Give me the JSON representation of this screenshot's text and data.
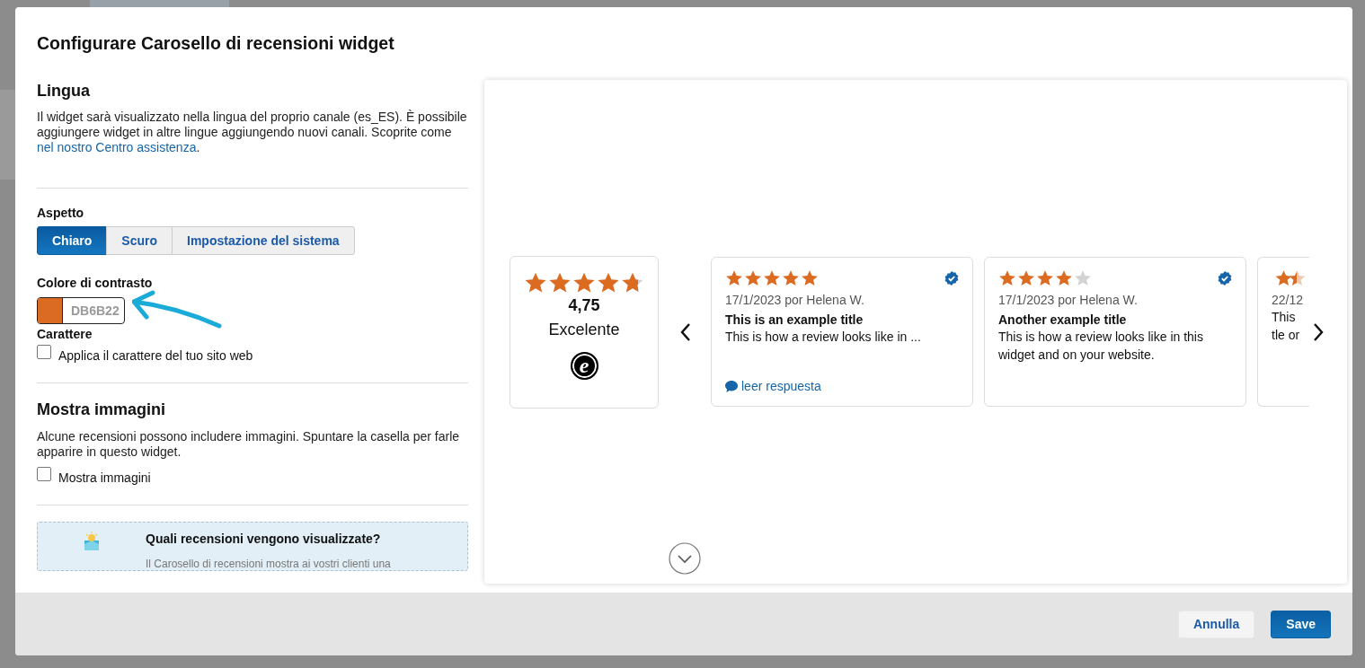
{
  "dialog": {
    "title": "Configurare Carosello di recensioni widget",
    "language": {
      "heading": "Lingua",
      "text": "Il widget sarà visualizzato nella lingua del proprio canale (es_ES). È possibile aggiungere widget in altre lingue aggiungendo nuovi canali. Scoprite come",
      "link": "nel nostro Centro assistenza",
      "after_link": "."
    },
    "appearance": {
      "label": "Aspetto",
      "options": [
        {
          "label": "Chiaro",
          "selected": true
        },
        {
          "label": "Scuro",
          "selected": false
        },
        {
          "label": "Impostazione del sistema",
          "selected": false
        }
      ]
    },
    "contrast_color": {
      "label": "Colore di contrasto",
      "color": "#db6b22",
      "value": "DB6B22"
    },
    "font": {
      "label": "Carattere",
      "checkbox": {
        "label": "Applica il carattere del tuo sito web",
        "checked": false
      }
    },
    "images": {
      "heading": "Mostra immagini",
      "text": "Alcune recensioni possono includere immagini. Spuntare la casella per farle apparire in questo widget.",
      "checkbox": {
        "label": "Mostra immagini",
        "checked": false
      }
    },
    "info_box": {
      "title": "Quali recensioni vengono visualizzate?",
      "text": "Il Carosello di recensioni mostra ai vostri clienti una"
    },
    "preview": {
      "summary": {
        "stars": 4.75,
        "score": "4,75",
        "rating_label": "Excelente",
        "logo_mark": "e"
      },
      "reviews": [
        {
          "kind": "full",
          "stars": 5,
          "verified": true,
          "date_author": "17/1/2023 por Helena W.",
          "title": "This is an example title",
          "lines": [
            "This is how a review looks like in ..."
          ],
          "reply_link": "leer respuesta"
        },
        {
          "kind": "full",
          "stars": 4,
          "verified": true,
          "date_author": "17/1/2023 por Helena W.",
          "title": "Another example title",
          "lines": [
            "This is how a review looks like in this",
            "widget and on your website."
          ]
        },
        {
          "kind": "partial",
          "date_author": "22/12",
          "lines": [
            "This",
            "tle or"
          ]
        }
      ]
    },
    "buttons": [
      {
        "label": "Annulla",
        "kind": "secondary"
      },
      {
        "label": "Save",
        "kind": "primary"
      }
    ]
  }
}
